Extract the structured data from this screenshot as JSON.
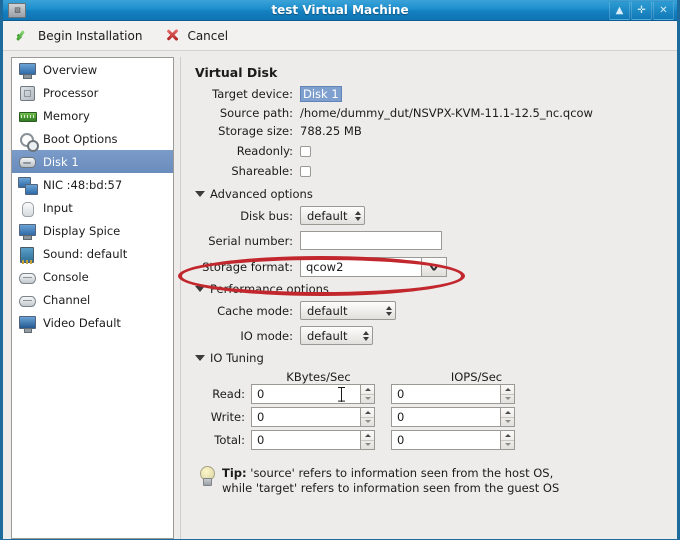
{
  "window": {
    "title": "test Virtual Machine",
    "icon": "app-icon",
    "buttons": {
      "minimize": "▲",
      "maximize": "✛",
      "close": "✕"
    }
  },
  "toolbar": {
    "begin_installation_label": "Begin Installation",
    "cancel_label": "Cancel"
  },
  "sidebar": {
    "items": [
      {
        "label": "Overview",
        "icon": "monitor-icon",
        "selected": false
      },
      {
        "label": "Processor",
        "icon": "cpu-icon",
        "selected": false
      },
      {
        "label": "Memory",
        "icon": "memory-icon",
        "selected": false
      },
      {
        "label": "Boot Options",
        "icon": "gears-icon",
        "selected": false
      },
      {
        "label": "Disk 1",
        "icon": "disk-icon",
        "selected": true
      },
      {
        "label": "NIC :48:bd:57",
        "icon": "network-icon",
        "selected": false
      },
      {
        "label": "Input",
        "icon": "mouse-icon",
        "selected": false
      },
      {
        "label": "Display Spice",
        "icon": "display-icon",
        "selected": false
      },
      {
        "label": "Sound: default",
        "icon": "sound-icon",
        "selected": false
      },
      {
        "label": "Console",
        "icon": "console-icon",
        "selected": false
      },
      {
        "label": "Channel",
        "icon": "channel-icon",
        "selected": false
      },
      {
        "label": "Video Default",
        "icon": "video-icon",
        "selected": false
      }
    ]
  },
  "main": {
    "section_title": "Virtual Disk",
    "fields": {
      "target_device_label": "Target device:",
      "target_device_value": "Disk 1",
      "source_path_label": "Source path:",
      "source_path_value": "/home/dummy_dut/NSVPX-KVM-11.1-12.5_nc.qcow",
      "storage_size_label": "Storage size:",
      "storage_size_value": "788.25 MB",
      "readonly_label": "Readonly:",
      "readonly_checked": false,
      "shareable_label": "Shareable:",
      "shareable_checked": false
    },
    "advanced": {
      "title": "Advanced options",
      "disk_bus_label": "Disk bus:",
      "disk_bus_value": "default",
      "serial_number_label": "Serial number:",
      "serial_number_value": "",
      "storage_format_label": "Storage format:",
      "storage_format_value": "qcow2"
    },
    "performance": {
      "title": "Performance options",
      "cache_mode_label": "Cache mode:",
      "cache_mode_value": "default",
      "io_mode_label": "IO mode:",
      "io_mode_value": "default"
    },
    "io_tuning": {
      "title": "IO Tuning",
      "col_kbytes": "KBytes/Sec",
      "col_iops": "IOPS/Sec",
      "rows": [
        {
          "label": "Read:",
          "kbytes": "0",
          "iops": "0"
        },
        {
          "label": "Write:",
          "kbytes": "0",
          "iops": "0"
        },
        {
          "label": "Total:",
          "kbytes": "0",
          "iops": "0"
        }
      ]
    },
    "tip": {
      "icon": "lightbulb-icon",
      "prefix": "Tip:",
      "line1": " 'source' refers to information seen from the host OS,",
      "line2": "while 'target' refers to information seen from the guest OS"
    }
  },
  "annotation": {
    "shape": "ellipse",
    "color": "#c2272d",
    "targets": "storage-format-row"
  }
}
